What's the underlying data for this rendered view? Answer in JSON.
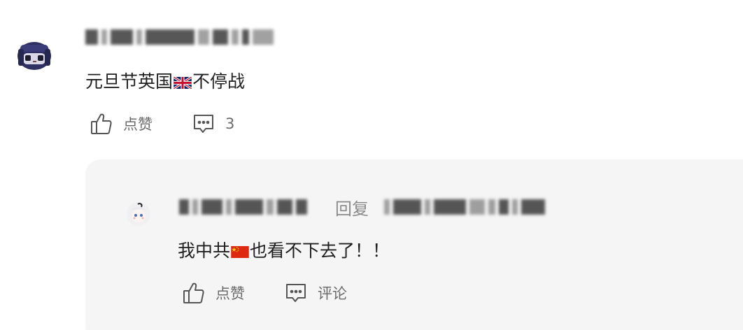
{
  "comment": {
    "text_before_flag": "元旦节英国",
    "flag_icon": "uk-flag-icon",
    "text_after_flag": "不停战",
    "actions": {
      "like_label": "点赞",
      "reply_count": "3"
    }
  },
  "reply": {
    "reply_word": "回复",
    "text_before_flag": "我中共",
    "flag_icon": "china-flag-icon",
    "text_after_flag": "也看不下去了！！",
    "actions": {
      "like_label": "点赞",
      "comment_label": "评论"
    }
  },
  "colors": {
    "action_text": "#6b6b6b",
    "reply_background": "#f5f5f5",
    "text": "#1f1f1f",
    "reply_word": "#8a8a8a"
  }
}
